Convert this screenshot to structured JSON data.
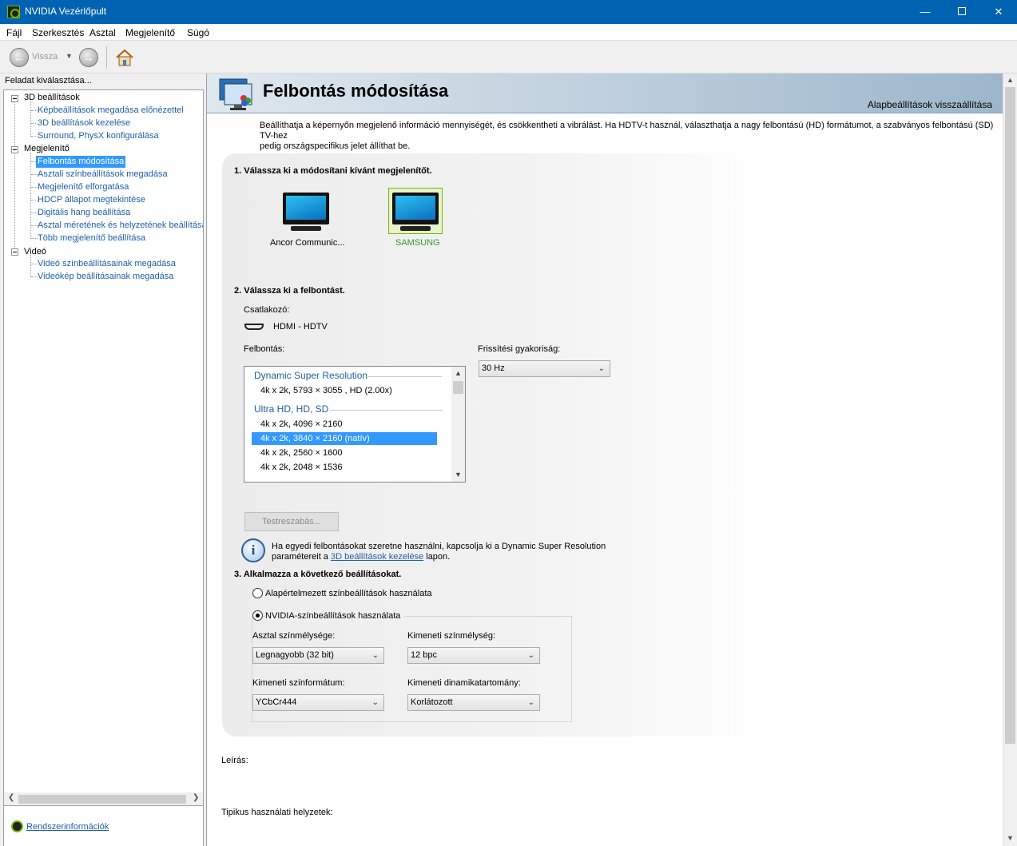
{
  "window": {
    "title": "NVIDIA Vezérlőpult",
    "controls": {
      "minimize": "—",
      "close": "✕"
    }
  },
  "menu": [
    "Fájl",
    "Szerkesztés",
    "Asztal",
    "Megjelenítő",
    "Súgó"
  ],
  "toolbar": {
    "back_label": "Vissza"
  },
  "sidebar": {
    "header": "Feladat kiválasztása...",
    "groups": [
      {
        "label": "3D beállítások",
        "items": [
          "Képbeállítások megadása előnézettel",
          "3D beállítások kezelése",
          "Surround, PhysX konfigurálása"
        ]
      },
      {
        "label": "Megjelenítő",
        "items": [
          "Felbontás módosítása",
          "Asztali színbeállítások megadása",
          "Megjelenítő elforgatása",
          "HDCP állapot megtekintése",
          "Digitális hang beállítása",
          "Asztal méretének és helyzetének beállítása",
          "Több megjelenítő beállítása"
        ]
      },
      {
        "label": "Videó",
        "items": [
          "Videó színbeállításainak megadása",
          "Videókép beállításainak megadása"
        ]
      }
    ],
    "selected": "Felbontás módosítása",
    "footer_link": "Rendszerinformációk"
  },
  "page": {
    "title": "Felbontás módosítása",
    "restore_defaults": "Alapbeállítások visszaállítása",
    "intro_line1": "Beállíthatja a képernyőn megjelenő információ mennyiségét, és csökkentheti a vibrálást. Ha HDTV-t használ, választhatja a nagy felbontású (HD) formátumot, a szabványos felbontású (SD) TV-hez",
    "intro_line2": "pedig országspecifikus jelet állíthat be.",
    "step1": {
      "heading": "1. Válassza ki a módosítani kívánt megjelenítőt.",
      "displays": [
        {
          "name": "Ancor Communic...",
          "selected": false
        },
        {
          "name": "SAMSUNG",
          "selected": true
        }
      ]
    },
    "step2": {
      "heading": "2. Válassza ki a felbontást.",
      "connector_label": "Csatlakozó:",
      "connector_value": "HDMI - HDTV",
      "resolution_label": "Felbontás:",
      "refresh_label": "Frissítési gyakoriság:",
      "refresh_value": "30 Hz",
      "list": {
        "group1": "Dynamic Super Resolution",
        "item1": "4k x 2k, 5793 × 3055 , HD (2.00x)",
        "group2": "Ultra HD, HD, SD",
        "items": [
          "4k x 2k, 4096 × 2160",
          "4k x 2k, 3840 × 2160 (natív)",
          "4k x 2k, 2560 × 1600",
          "4k x 2k, 2048 × 1536"
        ],
        "selected_index": 1
      },
      "customize_button": "Testreszabás...",
      "info_line1": "Ha egyedi felbontásokat szeretne használni, kapcsolja ki a Dynamic Super Resolution",
      "info_prefix": "paramétereit a",
      "info_link": "3D beállítások kezelése",
      "info_suffix": "lapon."
    },
    "step3": {
      "heading": "3. Alkalmazza a következő beállításokat.",
      "radio_default": "Alapértelmezett színbeállítások használata",
      "radio_nvidia": "NVIDIA-színbeállítások használata",
      "selected_radio": "nvidia",
      "desktop_depth_label": "Asztal színmélysége:",
      "desktop_depth_value": "Legnagyobb (32 bit)",
      "output_depth_label": "Kimeneti színmélység:",
      "output_depth_value": "12 bpc",
      "output_format_label": "Kimeneti színformátum:",
      "output_format_value": "YCbCr444",
      "dynamic_range_label": "Kimeneti dinamikatartomány:",
      "dynamic_range_value": "Korlátozott"
    },
    "description_label": "Leírás:",
    "typical_usage_label": "Tipikus használati helyzetek:"
  },
  "colors": {
    "titlebar": "#0063b1",
    "selection": "#3399ff",
    "link": "#1f5fa8",
    "nvidia_green": "#76b900",
    "selected_display_label": "#3a9a1a"
  }
}
